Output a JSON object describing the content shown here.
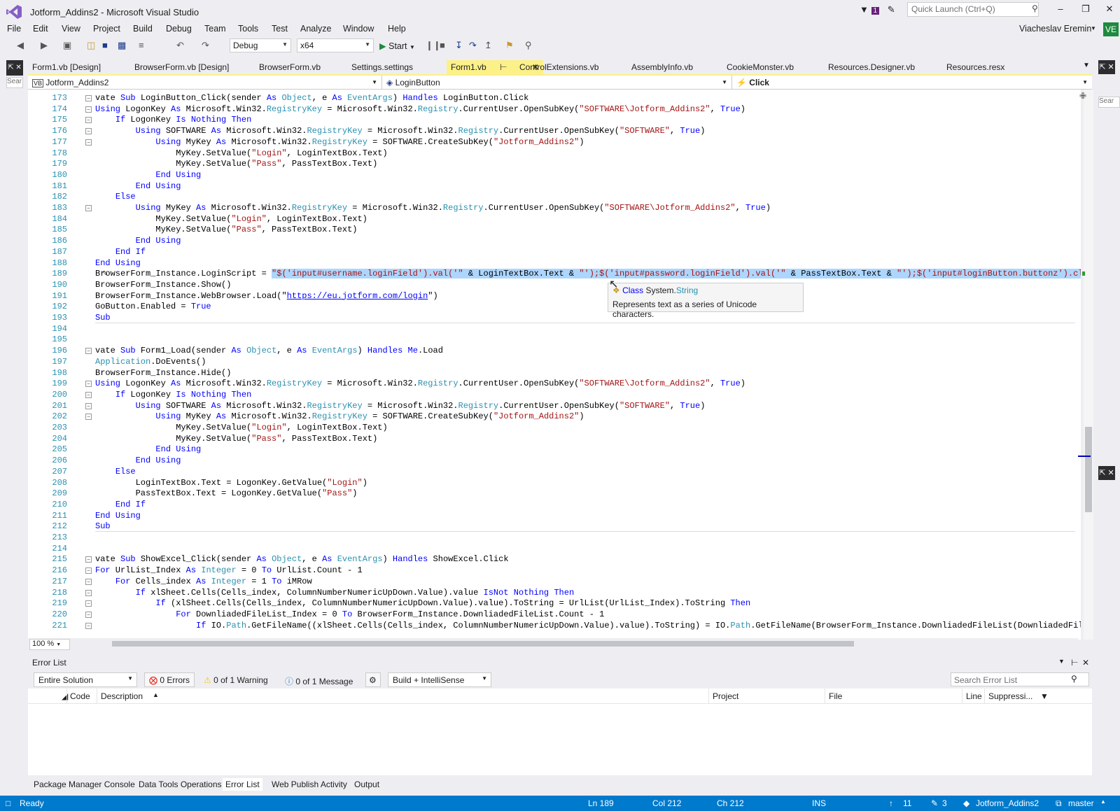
{
  "window": {
    "title": "Jotform_Addins2 - Microsoft Visual Studio",
    "feedback_count": "1",
    "quick_launch_placeholder": "Quick Launch (Ctrl+Q)",
    "user": "Viacheslav Eremin",
    "user_initials": "VE"
  },
  "menu": [
    "File",
    "Edit",
    "View",
    "Project",
    "Build",
    "Debug",
    "Team",
    "Tools",
    "Test",
    "Analyze",
    "Window",
    "Help"
  ],
  "toolbar": {
    "config": "Debug",
    "platform": "x64",
    "start_label": "Start"
  },
  "tabs": [
    {
      "label": "Form1.vb [Design]",
      "active": false
    },
    {
      "label": "BrowserForm.vb [Design]",
      "active": false
    },
    {
      "label": "BrowserForm.vb",
      "active": false
    },
    {
      "label": "Settings.settings",
      "active": false
    },
    {
      "label": "Form1.vb",
      "active": true
    },
    {
      "label": "ControlExtensions.vb",
      "active": false
    },
    {
      "label": "AssemblyInfo.vb",
      "active": false
    },
    {
      "label": "CookieMonster.vb",
      "active": false
    },
    {
      "label": "Resources.Designer.vb",
      "active": false
    },
    {
      "label": "Resources.resx",
      "active": false
    }
  ],
  "nav": {
    "project": "Jotform_Addins2",
    "object": "LoginButton",
    "member": "Click"
  },
  "left_strip": {
    "search_placeholder": "Sear"
  },
  "right_strip": {
    "search_placeholder": "Sear"
  },
  "code_lines": [
    {
      "n": "173",
      "t": "vate Sub LoginButton_Click(sender As Object, e As EventArgs) Handles LoginButton.Click"
    },
    {
      "n": "174",
      "t": "Using LogonKey As Microsoft.Win32.RegistryKey = Microsoft.Win32.Registry.CurrentUser.OpenSubKey(\"SOFTWARE\\Jotform_Addins2\", True)"
    },
    {
      "n": "175",
      "t": "    If LogonKey Is Nothing Then"
    },
    {
      "n": "176",
      "t": "        Using SOFTWARE As Microsoft.Win32.RegistryKey = Microsoft.Win32.Registry.CurrentUser.OpenSubKey(\"SOFTWARE\", True)"
    },
    {
      "n": "177",
      "t": "            Using MyKey As Microsoft.Win32.RegistryKey = SOFTWARE.CreateSubKey(\"Jotform_Addins2\")"
    },
    {
      "n": "178",
      "t": "                MyKey.SetValue(\"Login\", LoginTextBox.Text)"
    },
    {
      "n": "179",
      "t": "                MyKey.SetValue(\"Pass\", PassTextBox.Text)"
    },
    {
      "n": "180",
      "t": "            End Using"
    },
    {
      "n": "181",
      "t": "        End Using"
    },
    {
      "n": "182",
      "t": "    Else"
    },
    {
      "n": "183",
      "t": "        Using MyKey As Microsoft.Win32.RegistryKey = Microsoft.Win32.Registry.CurrentUser.OpenSubKey(\"SOFTWARE\\Jotform_Addins2\", True)"
    },
    {
      "n": "184",
      "t": "            MyKey.SetValue(\"Login\", LoginTextBox.Text)"
    },
    {
      "n": "185",
      "t": "            MyKey.SetValue(\"Pass\", PassTextBox.Text)"
    },
    {
      "n": "186",
      "t": "        End Using"
    },
    {
      "n": "187",
      "t": "    End If"
    },
    {
      "n": "188",
      "t": "End Using"
    },
    {
      "n": "189",
      "t": "BrowserForm_Instance.LoginScript = \"$('input#username.loginField').val('\" & LoginTextBox.Text & \"');$('input#password.loginField').val('\" & PassTextBox.Text & \"');$('input#loginButton.buttonz').click("
    },
    {
      "n": "190",
      "t": "BrowserForm_Instance.Show()"
    },
    {
      "n": "191",
      "t": "BrowserForm_Instance.WebBrowser.Load(\"https://eu.jotform.com/login\")"
    },
    {
      "n": "192",
      "t": "GoButton.Enabled = True"
    },
    {
      "n": "193",
      "t": "Sub"
    },
    {
      "n": "194",
      "t": ""
    },
    {
      "n": "195",
      "t": ""
    },
    {
      "n": "196",
      "t": "vate Sub Form1_Load(sender As Object, e As EventArgs) Handles Me.Load"
    },
    {
      "n": "197",
      "t": "Application.DoEvents()"
    },
    {
      "n": "198",
      "t": "BrowserForm_Instance.Hide()"
    },
    {
      "n": "199",
      "t": "Using LogonKey As Microsoft.Win32.RegistryKey = Microsoft.Win32.Registry.CurrentUser.OpenSubKey(\"SOFTWARE\\Jotform_Addins2\", True)"
    },
    {
      "n": "200",
      "t": "    If LogonKey Is Nothing Then"
    },
    {
      "n": "201",
      "t": "        Using SOFTWARE As Microsoft.Win32.RegistryKey = Microsoft.Win32.Registry.CurrentUser.OpenSubKey(\"SOFTWARE\", True)"
    },
    {
      "n": "202",
      "t": "            Using MyKey As Microsoft.Win32.RegistryKey = SOFTWARE.CreateSubKey(\"Jotform_Addins2\")"
    },
    {
      "n": "203",
      "t": "                MyKey.SetValue(\"Login\", LoginTextBox.Text)"
    },
    {
      "n": "204",
      "t": "                MyKey.SetValue(\"Pass\", PassTextBox.Text)"
    },
    {
      "n": "205",
      "t": "            End Using"
    },
    {
      "n": "206",
      "t": "        End Using"
    },
    {
      "n": "207",
      "t": "    Else"
    },
    {
      "n": "208",
      "t": "        LoginTextBox.Text = LogonKey.GetValue(\"Login\")"
    },
    {
      "n": "209",
      "t": "        PassTextBox.Text = LogonKey.GetValue(\"Pass\")"
    },
    {
      "n": "210",
      "t": "    End If"
    },
    {
      "n": "211",
      "t": "End Using"
    },
    {
      "n": "212",
      "t": "Sub"
    },
    {
      "n": "213",
      "t": ""
    },
    {
      "n": "214",
      "t": ""
    },
    {
      "n": "215",
      "t": "vate Sub ShowExcel_Click(sender As Object, e As EventArgs) Handles ShowExcel.Click"
    },
    {
      "n": "216",
      "t": "For UrlList_Index As Integer = 0 To UrlList.Count - 1"
    },
    {
      "n": "217",
      "t": "    For Cells_index As Integer = 1 To iMRow"
    },
    {
      "n": "218",
      "t": "        If xlSheet.Cells(Cells_index, ColumnNumberNumericUpDown.Value).value IsNot Nothing Then"
    },
    {
      "n": "219",
      "t": "            If (xlSheet.Cells(Cells_index, ColumnNumberNumericUpDown.Value).value).ToString = UrlList(UrlList_Index).ToString Then"
    },
    {
      "n": "220",
      "t": "                For DownliadedFileList_Index = 0 To BrowserForm_Instance.DownliadedFileList.Count - 1"
    },
    {
      "n": "221",
      "t": "                    If IO.Path.GetFileName((xlSheet.Cells(Cells_index, ColumnNumberNumericUpDown.Value).value).ToString) = IO.Path.GetFileName(BrowserForm_Instance.DownliadedFileList(DownliadedFileLis"
    }
  ],
  "tooltip": {
    "kind": "Class",
    "namespace": "System.",
    "type": "String",
    "description": "Represents text as a series of Unicode characters."
  },
  "editor": {
    "zoom": "100 %"
  },
  "error_list": {
    "title": "Error List",
    "scope": "Entire Solution",
    "errors": "0 Errors",
    "warnings": "0 of 1 Warning",
    "messages": "0 of 1 Message",
    "build_filter": "Build + IntelliSense",
    "search_placeholder": "Search Error List",
    "columns": [
      "Code",
      "Description",
      "Project",
      "File",
      "Line",
      "Suppressi..."
    ]
  },
  "bottom_tabs": [
    {
      "label": "Package Manager Console",
      "active": false
    },
    {
      "label": "Data Tools Operations",
      "active": false
    },
    {
      "label": "Error List",
      "active": true
    },
    {
      "label": "Web Publish Activity",
      "active": false
    },
    {
      "label": "Output",
      "active": false
    }
  ],
  "status": {
    "state": "Ready",
    "ln": "Ln 189",
    "col": "Col 212",
    "ch": "Ch 212",
    "mode": "INS",
    "up": "11",
    "pending": "3",
    "repo": "Jotform_Addins2",
    "branch": "master"
  },
  "colors": {
    "accent": "#007acc",
    "active_tab": "#fcf089",
    "selection": "#add6ff",
    "keyword": "#0000ff",
    "type": "#2b91af",
    "string": "#a31515"
  }
}
